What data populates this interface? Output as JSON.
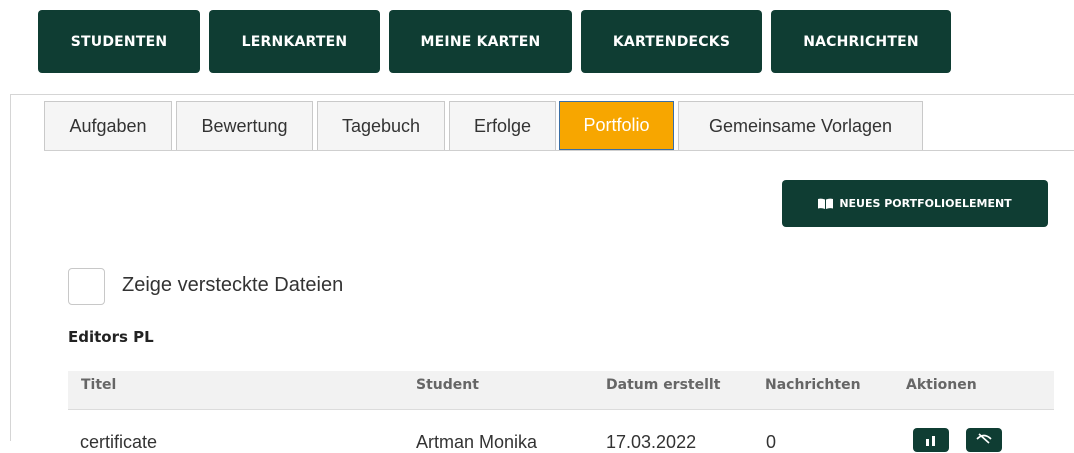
{
  "topnav": [
    {
      "label": "STUDENTEN"
    },
    {
      "label": "LERNKARTEN"
    },
    {
      "label": "MEINE KARTEN"
    },
    {
      "label": "KARTENDECKS"
    },
    {
      "label": "NACHRICHTEN"
    }
  ],
  "tabs": [
    {
      "label": "Aufgaben"
    },
    {
      "label": "Bewertung"
    },
    {
      "label": "Tagebuch"
    },
    {
      "label": "Erfolge"
    },
    {
      "label": "Portfolio",
      "active": true
    },
    {
      "label": "Gemeinsame Vorlagen"
    }
  ],
  "new_button": {
    "label": "NEUES PORTFOLIOELEMENT",
    "icon": "book-open-icon"
  },
  "show_hidden": {
    "label": "Zeige versteckte Dateien",
    "checked": false
  },
  "section": {
    "title": "Editors PL"
  },
  "table": {
    "columns": [
      "Titel",
      "Student",
      "Datum erstellt",
      "Nachrichten",
      "Aktionen"
    ],
    "rows": [
      {
        "titel": "certificate",
        "student": "Artman Monika",
        "datum": "17.03.2022",
        "nachrichten": "0",
        "actions": [
          "stats-icon",
          "hide-icon"
        ]
      }
    ]
  },
  "colors": {
    "primary": "#0f3d33",
    "active_tab": "#f7a600",
    "header_bg": "#f2f2f2"
  }
}
